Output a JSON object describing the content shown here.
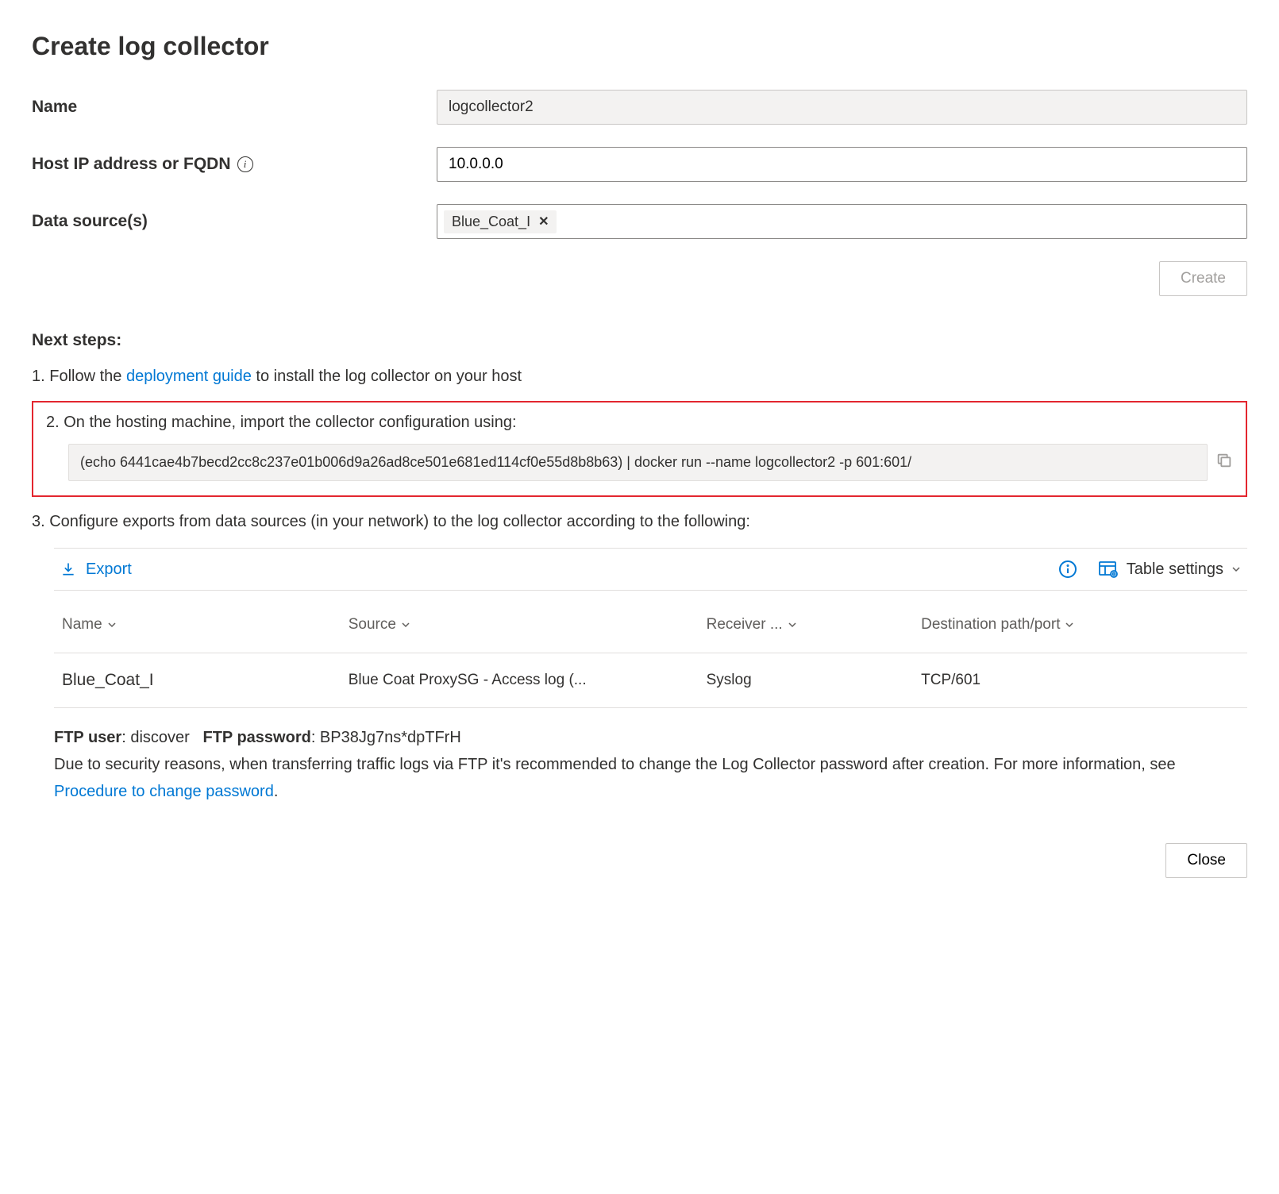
{
  "title": "Create log collector",
  "fields": {
    "name_label": "Name",
    "name_value": "logcollector2",
    "host_label": "Host IP address or FQDN",
    "host_value": "10.0.0.0",
    "sources_label": "Data source(s)",
    "source_tag": "Blue_Coat_I"
  },
  "buttons": {
    "create": "Create",
    "close": "Close"
  },
  "steps": {
    "heading": "Next steps:",
    "s1_prefix": "1. Follow the ",
    "s1_link": "deployment guide",
    "s1_suffix": " to install the log collector on your host",
    "s2": "2. On the hosting machine, import the collector configuration using:",
    "command": "(echo 6441cae4b7becd2cc8c237e01b006d9a26ad8ce501e681ed114cf0e55d8b8b63) | docker run --name logcollector2 -p 601:601/",
    "s3": "3. Configure exports from data sources (in your network) to the log collector according to the following:"
  },
  "toolbar": {
    "export": "Export",
    "table_settings": "Table settings"
  },
  "table": {
    "col_name": "Name",
    "col_source": "Source",
    "col_receiver": "Receiver ...",
    "col_dest": "Destination path/port",
    "row": {
      "name": "Blue_Coat_I",
      "source": "Blue Coat ProxySG - Access log (...",
      "receiver": "Syslog",
      "dest": "TCP/601"
    }
  },
  "ftp": {
    "user_label": "FTP user",
    "user_value": ": discover",
    "pw_label": "FTP password",
    "pw_value": ": BP38Jg7ns*dpTFrH",
    "note_prefix": "Due to security reasons, when transferring traffic logs via FTP it's recommended to change the Log Collector password after creation. For more information, see ",
    "note_link": "Procedure to change password",
    "note_suffix": "."
  }
}
